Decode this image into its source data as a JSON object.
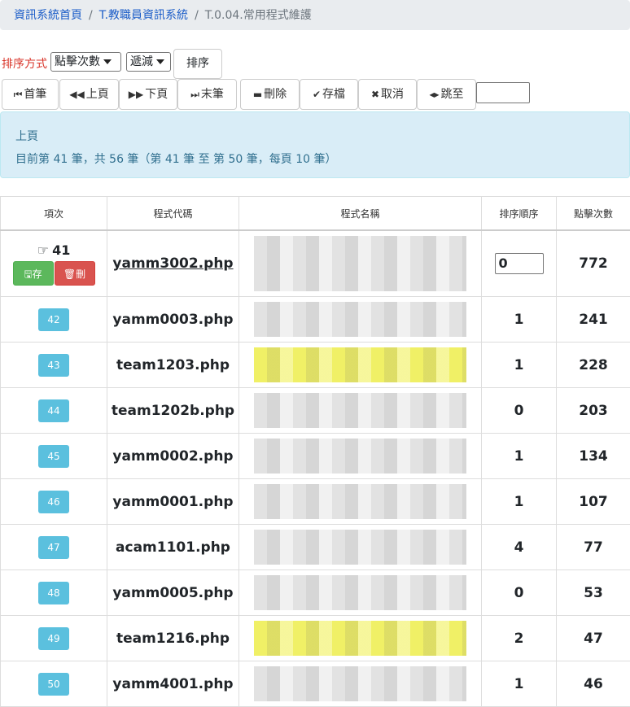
{
  "breadcrumb": {
    "items": [
      "資訊系統首頁",
      "T.教職員資訊系統"
    ],
    "active": "T.0.04.常用程式維護"
  },
  "sort": {
    "label": "排序方式",
    "field_selected": "點擊次數",
    "direction_selected": "遞減",
    "button": "排序"
  },
  "toolbar": {
    "first": "首筆",
    "prev": "上頁",
    "next": "下頁",
    "last": "末筆",
    "delete": "刪除",
    "save": "存檔",
    "cancel": "取消",
    "jump": "跳至",
    "jump_value": ""
  },
  "alert": {
    "line1": "上頁",
    "line2": "目前第 41 筆，共 56 筆（第 41 筆 至 第 50 筆，每頁 10 筆）"
  },
  "table": {
    "headers": [
      "項次",
      "程式代碼",
      "程式名稱",
      "排序順序",
      "點擊次數"
    ],
    "current": {
      "index": "41",
      "save_label": "存",
      "delete_label": "刪",
      "code": "yamm3002.php",
      "order": "0",
      "clicks": "772"
    },
    "rows": [
      {
        "index": "42",
        "code": "yamm0003.php",
        "order": "1",
        "clicks": "241"
      },
      {
        "index": "43",
        "code": "team1203.php",
        "order": "1",
        "clicks": "228"
      },
      {
        "index": "44",
        "code": "team1202b.php",
        "order": "0",
        "clicks": "203"
      },
      {
        "index": "45",
        "code": "yamm0002.php",
        "order": "1",
        "clicks": "134"
      },
      {
        "index": "46",
        "code": "yamm0001.php",
        "order": "1",
        "clicks": "107"
      },
      {
        "index": "47",
        "code": "acam1101.php",
        "order": "4",
        "clicks": "77"
      },
      {
        "index": "48",
        "code": "yamm0005.php",
        "order": "0",
        "clicks": "53"
      },
      {
        "index": "49",
        "code": "team1216.php",
        "order": "2",
        "clicks": "47"
      },
      {
        "index": "50",
        "code": "yamm4001.php",
        "order": "1",
        "clicks": "46"
      }
    ]
  }
}
